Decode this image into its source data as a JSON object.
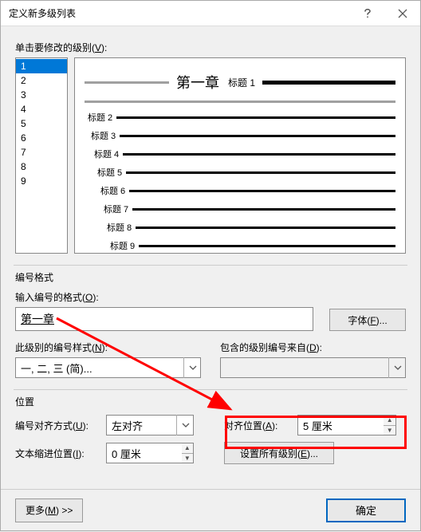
{
  "titlebar": {
    "title": "定义新多级列表"
  },
  "levels": {
    "label_pre": "单击要修改的级别(",
    "label_key": "V",
    "label_post": "):",
    "items": [
      "1",
      "2",
      "3",
      "4",
      "5",
      "6",
      "7",
      "8",
      "9"
    ],
    "selected": "1"
  },
  "preview": {
    "chapter": "第一章",
    "heading_prefix": "标题",
    "headings": [
      "标题 1",
      "标题 2",
      "标题 3",
      "标题 4",
      "标题 5",
      "标题 6",
      "标题 7",
      "标题 8",
      "标题 9"
    ]
  },
  "numfmt": {
    "section": "编号格式",
    "enter_label_pre": "输入编号的格式(",
    "enter_label_key": "O",
    "enter_label_post": "):",
    "value": "第一章",
    "font_btn_pre": "字体(",
    "font_btn_key": "F",
    "font_btn_post": ")...",
    "style_label_pre": "此级别的编号样式(",
    "style_label_key": "N",
    "style_label_post": "):",
    "style_value": "一, 二, 三 (简)...",
    "include_label_pre": "包含的级别编号来自(",
    "include_label_key": "D",
    "include_label_post": "):",
    "include_value": ""
  },
  "position": {
    "section": "位置",
    "align_label_pre": "编号对齐方式(",
    "align_label_key": "U",
    "align_label_post": "):",
    "align_value": "左对齐",
    "alignat_label_pre": "对齐位置(",
    "alignat_label_key": "A",
    "alignat_label_post": "):",
    "alignat_value": "5 厘米",
    "indent_label_pre": "文本缩进位置(",
    "indent_label_key": "I",
    "indent_label_post": "):",
    "indent_value": "0 厘米",
    "setall_pre": "设置所有级别(",
    "setall_key": "E",
    "setall_post": ")..."
  },
  "footer": {
    "more_pre": "更多(",
    "more_key": "M",
    "more_post": ") >>",
    "ok": "确定"
  }
}
